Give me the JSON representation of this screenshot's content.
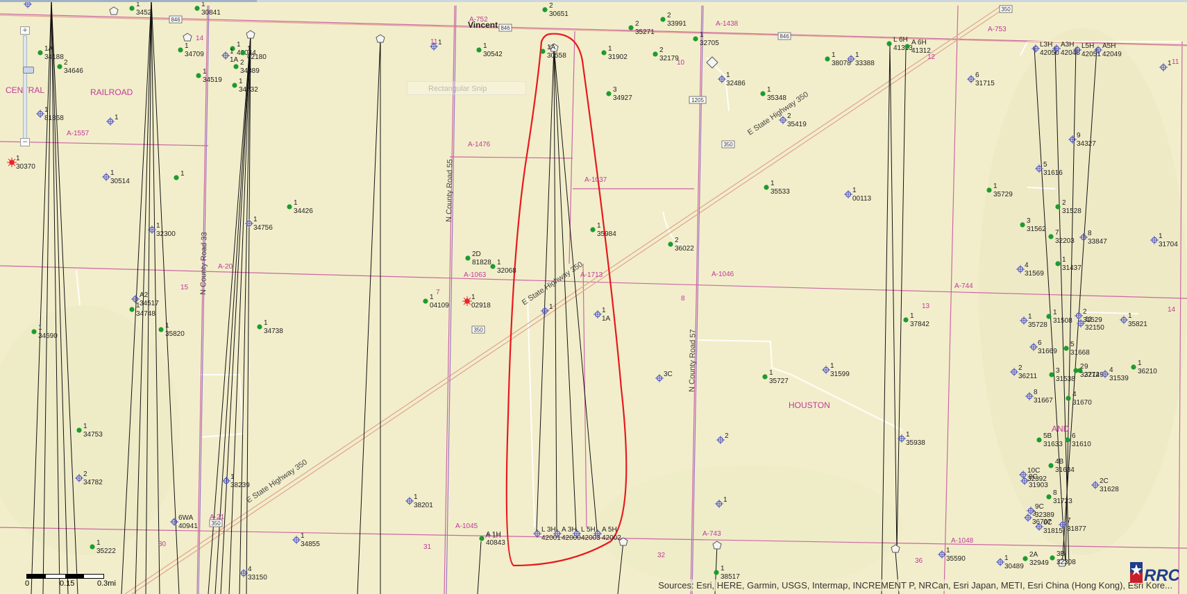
{
  "colors": {
    "background": "#f2eecb",
    "survey_line": "#cc66a3",
    "section_label": "#c0399a",
    "road": "#e8b4a6",
    "permit_outline": "#e8181e",
    "well_green": "#1e9b2d",
    "well_blue": "#4f56c6",
    "well_red": "#e8262b"
  },
  "map_controls": {
    "zoom_in_symbol": "+",
    "zoom_out_symbol": "−",
    "ghost_tool_label": "Rectangular Snip"
  },
  "scale_bar": {
    "labels": [
      "0",
      "0.15",
      "0.3mi"
    ]
  },
  "attribution": "Sources: Esri, HERE, Garmin, USGS, Intermap, INCREMENT P, NRCan, Esri Japan, METI, Esri China (Hong Kong), Esri Kore...",
  "logo": {
    "text": "RRC"
  },
  "place_labels": [
    "Vincent",
    "CENTRAL",
    "RAILROAD",
    "HOUSTON",
    "AND"
  ],
  "road_labels": [
    "E State Highway 350",
    "E State Highway 350",
    "E State Highway 350",
    "N County Road 55",
    "N County Road 33",
    "N County Road 57"
  ],
  "shields": [
    "846",
    "846",
    "846",
    "350",
    "350",
    "350",
    "1205",
    "350"
  ],
  "survey_labels": [
    "A-752",
    "A-1438",
    "A-753",
    "A-1557",
    "A-1476",
    "A-1037",
    "A-20",
    "A-1063",
    "A-1713",
    "A-1046",
    "A-744",
    "A-1045",
    "A-1H",
    "A-743",
    "A-1048",
    "A-21"
  ],
  "section_numbers": [
    "14",
    "11",
    "10",
    "12",
    "11",
    "15",
    "7",
    "8",
    "13",
    "14",
    "30",
    "31",
    "32",
    "36"
  ],
  "wells_green": [
    [
      "1",
      "3452"
    ],
    [
      "1",
      "30841"
    ],
    [
      "2",
      "30651"
    ],
    [
      "2",
      "35271"
    ],
    [
      "2",
      "33991"
    ],
    [
      "1A",
      "34188"
    ],
    [
      "1",
      "42044"
    ],
    [
      "1",
      "34709"
    ],
    [
      "1",
      "02180"
    ],
    [
      "2",
      "34646"
    ],
    [
      "2",
      "34889"
    ],
    [
      "1",
      "30542"
    ],
    [
      "1A",
      "30558"
    ],
    [
      "1",
      "31902"
    ],
    [
      "2",
      "32179"
    ],
    [
      "1",
      "32705"
    ],
    [
      "1",
      "34519"
    ],
    [
      "1",
      "34732"
    ],
    [
      "1",
      "38078"
    ],
    [
      "L 6H",
      "41313"
    ],
    [
      "A 6H",
      "41312"
    ],
    [
      "3",
      "34927"
    ],
    [
      "1",
      "35348"
    ],
    [
      "1",
      ""
    ],
    [
      "1",
      "34426"
    ],
    [
      "1",
      "35533"
    ],
    [
      "1",
      "35729"
    ],
    [
      "1",
      "35984"
    ],
    [
      "2",
      "36022"
    ],
    [
      "2D",
      "81828"
    ],
    [
      "1",
      "32068"
    ],
    [
      "2",
      "31528"
    ],
    [
      "3",
      "31562"
    ],
    [
      "7",
      "32203"
    ],
    [
      "1",
      "31437"
    ],
    [
      "1",
      "04109"
    ],
    [
      "1",
      "34748"
    ],
    [
      "1",
      "35820"
    ],
    [
      "1",
      "34738"
    ],
    [
      "1",
      "34690"
    ],
    [
      "1",
      "37842"
    ],
    [
      "1",
      "31508"
    ],
    [
      "5",
      "31668"
    ],
    [
      "9",
      "32149"
    ],
    [
      "2",
      "32772"
    ],
    [
      "3",
      "31538"
    ],
    [
      "4",
      "31670"
    ],
    [
      "1",
      "35727"
    ],
    [
      "1",
      "34753"
    ],
    [
      "5B",
      "31633"
    ],
    [
      "6",
      "31610"
    ],
    [
      "4B",
      "31634"
    ],
    [
      "8",
      "31723"
    ],
    [
      "1",
      "36210"
    ],
    [
      "1",
      "35222"
    ],
    [
      "A 1H",
      "40843"
    ],
    [
      "1",
      "38517"
    ],
    [
      "3B",
      "32308"
    ],
    [
      "2A",
      "32949"
    ]
  ],
  "wells_blue": [
    [
      "1",
      ""
    ],
    [
      "1",
      "1A"
    ],
    [
      "1",
      "81868"
    ],
    [
      "1",
      ""
    ],
    [
      "1",
      "30514"
    ],
    [
      "1",
      "32300"
    ],
    [
      "1",
      "34756"
    ],
    [
      "A2",
      "34517"
    ],
    [
      "1",
      ""
    ],
    [
      "1",
      "1A"
    ],
    [
      "1",
      ""
    ],
    [
      "3C",
      ""
    ],
    [
      "2",
      ""
    ],
    [
      "1",
      ""
    ],
    [
      "1",
      "38201"
    ],
    [
      "1",
      "38239"
    ],
    [
      "2",
      "34782"
    ],
    [
      "6WA",
      "40941"
    ],
    [
      "1",
      "34855"
    ],
    [
      "4",
      "33150"
    ],
    [
      "1",
      "32486"
    ],
    [
      "2",
      "35419"
    ],
    [
      "1",
      "33388"
    ],
    [
      "6",
      "31715"
    ],
    [
      "9",
      "34327"
    ],
    [
      "5",
      "31616"
    ],
    [
      "1",
      "00113"
    ],
    [
      "8",
      "33847"
    ],
    [
      "1",
      "31704"
    ],
    [
      "4",
      "31569"
    ],
    [
      "1",
      "35728"
    ],
    [
      "2",
      "31529"
    ],
    [
      "1",
      "35821"
    ],
    [
      "11",
      "32150"
    ],
    [
      "6",
      "31669"
    ],
    [
      "1",
      "31599"
    ],
    [
      "2",
      "36211"
    ],
    [
      "4",
      "31539"
    ],
    [
      "8",
      "31667"
    ],
    [
      "1",
      "35938"
    ],
    [
      "10C",
      "32392"
    ],
    [
      "8C",
      "31903"
    ],
    [
      "2C",
      "31628"
    ],
    [
      "9C",
      "32389"
    ],
    [
      "3",
      "36707"
    ],
    [
      "6C",
      "31815"
    ],
    [
      "7",
      "31877"
    ],
    [
      "1",
      "35590"
    ],
    [
      "1",
      "30489"
    ],
    [
      "L 3H",
      "42001"
    ],
    [
      "A 3H",
      "42000"
    ],
    [
      "L 5H",
      "42003"
    ],
    [
      "A 5H",
      "42002"
    ],
    [
      "L3H",
      "42050"
    ],
    [
      "A3H",
      "42048"
    ],
    [
      "L5H",
      "42051"
    ],
    [
      "A5H",
      "42049"
    ],
    [
      "1",
      ""
    ]
  ],
  "wells_red": [
    [
      "1",
      "30370"
    ],
    [
      "1",
      "02918"
    ]
  ]
}
